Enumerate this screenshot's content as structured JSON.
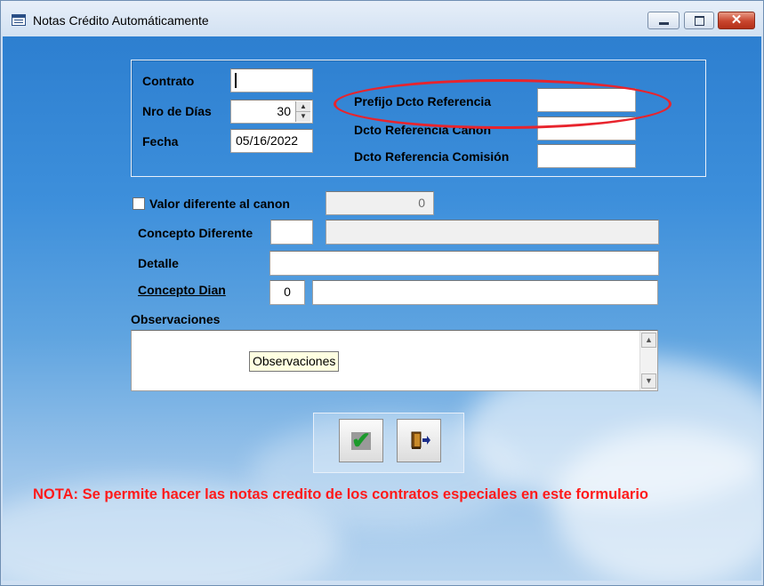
{
  "window": {
    "title": "Notas Crédito Automáticamente",
    "close_glyph": "✕"
  },
  "form": {
    "contrato_label": "Contrato",
    "contrato_value": "",
    "nro_dias_label": "Nro de Días",
    "nro_dias_value": "30",
    "fecha_label": "Fecha",
    "fecha_value": "05/16/2022",
    "prefijo_label": "Prefijo Dcto Referencia",
    "prefijo_value": "",
    "dcto_canon_label": "Dcto Referencia Canon",
    "dcto_canon_value": "",
    "dcto_comision_label": "Dcto Referencia Comisión",
    "dcto_comision_value": "",
    "valor_diferente_label": "Valor diferente al canon",
    "valor_diferente_checked": false,
    "valor_diferente_value": "0",
    "concepto_diferente_label": "Concepto Diferente",
    "concepto_diferente_code": "",
    "concepto_diferente_desc": "",
    "detalle_label": "Detalle",
    "detalle_value": "",
    "concepto_dian_label": "Concepto Dian",
    "concepto_dian_code": "0",
    "concepto_dian_desc": "",
    "observaciones_label": "Observaciones",
    "observaciones_value": "",
    "tooltip": "Observaciones"
  },
  "buttons": {
    "accept_icon": "checkmark-icon",
    "exit_icon": "exit-door-icon"
  },
  "note": "NOTA: Se permite hacer las notas credito de los contratos especiales en este formulario",
  "colors": {
    "note": "#ff1a1a",
    "annotation_ellipse": "#e8242d",
    "check": "#1b9a2b"
  }
}
